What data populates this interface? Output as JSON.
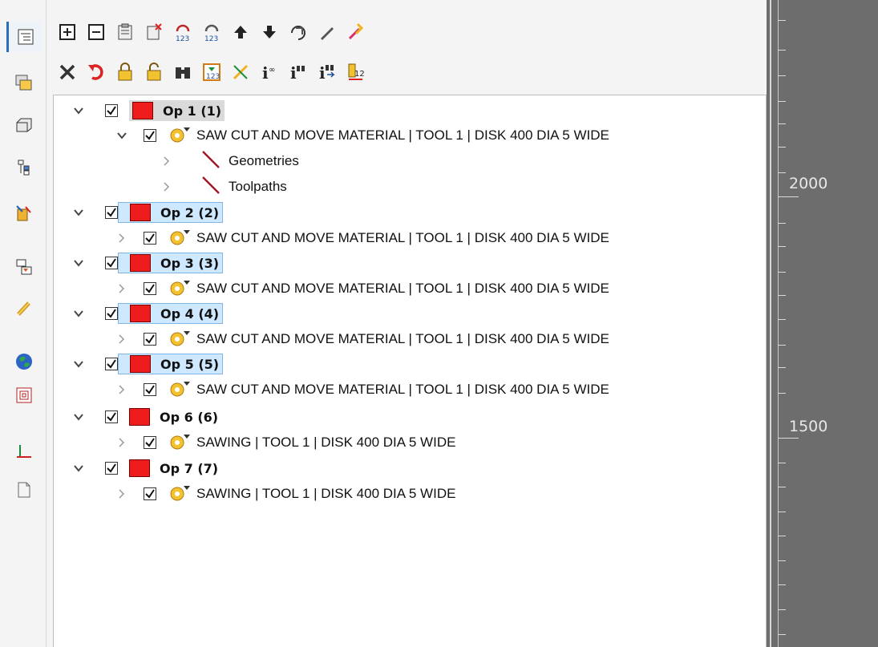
{
  "toolbar": {
    "row1": [
      "expand-all",
      "collapse-all",
      "clipboard",
      "delete-doc",
      "renumber",
      "renumber-alt",
      "move-up",
      "move-down",
      "regenerate",
      "pencil",
      "magic"
    ],
    "row2": [
      "delete",
      "undo",
      "lock",
      "unlock",
      "find",
      "renumber-ops",
      "stats",
      "info",
      "info-find",
      "info-move",
      "number-12"
    ]
  },
  "sidebar": [
    "operations-manager",
    "tabs",
    "solids",
    "tree",
    "path",
    "transfer",
    "link",
    "globe",
    "layers",
    "axis",
    "document"
  ],
  "tree": {
    "ops": [
      {
        "label": "Op 1 (1)",
        "children": [
          {
            "text": "SAW CUT AND MOVE MATERIAL | TOOL 1 | DISK 400 DIA 5 WIDE",
            "sub": [
              "Geometries",
              "Toolpaths"
            ]
          }
        ]
      },
      {
        "label": "Op 2 (2)",
        "children": [
          {
            "text": "SAW CUT AND MOVE MATERIAL | TOOL 1 | DISK 400 DIA 5 WIDE"
          }
        ]
      },
      {
        "label": "Op 3 (3)",
        "children": [
          {
            "text": "SAW CUT AND MOVE MATERIAL | TOOL 1 | DISK 400 DIA 5 WIDE"
          }
        ]
      },
      {
        "label": "Op 4 (4)",
        "children": [
          {
            "text": "SAW CUT AND MOVE MATERIAL | TOOL 1 | DISK 400 DIA 5 WIDE"
          }
        ]
      },
      {
        "label": "Op 5 (5)",
        "children": [
          {
            "text": "SAW CUT AND MOVE MATERIAL | TOOL 1 | DISK 400 DIA 5 WIDE"
          }
        ]
      },
      {
        "label": "Op 6 (6)",
        "children": [
          {
            "text": "SAWING | TOOL 1 | DISK 400 DIA 5 WIDE"
          }
        ]
      },
      {
        "label": "Op 7 (7)",
        "children": [
          {
            "text": "SAWING | TOOL 1 | DISK 400 DIA 5 WIDE"
          }
        ]
      }
    ]
  },
  "ruler": {
    "labels": [
      "2000",
      "1500"
    ]
  },
  "colors": {
    "op_marker": "#ee1c1c",
    "selection": "#cde8ff",
    "ruler_bg": "#6d6d6d"
  }
}
